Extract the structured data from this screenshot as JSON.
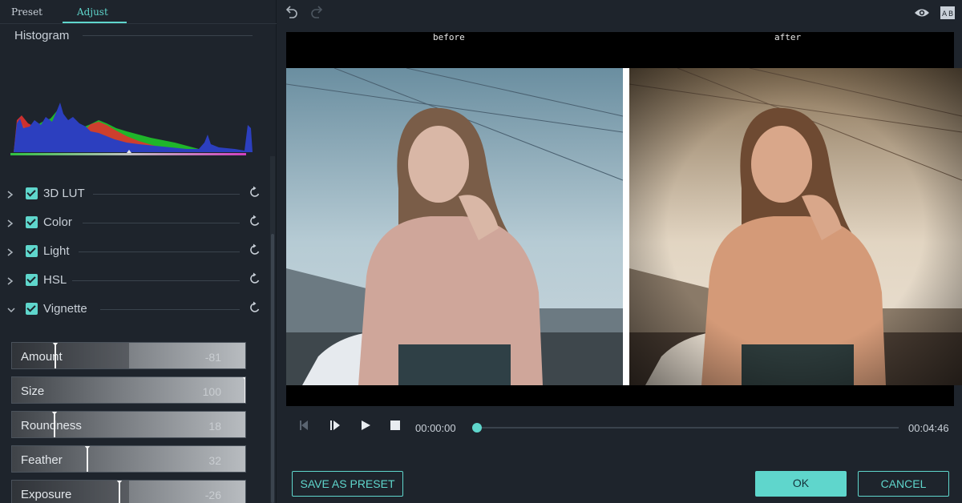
{
  "tabs": {
    "preset": "Preset",
    "adjust": "Adjust",
    "active": "adjust"
  },
  "histogram": {
    "title": "Histogram"
  },
  "sections": [
    {
      "label": "3D LUT",
      "checked": true,
      "expanded": false
    },
    {
      "label": "Color",
      "checked": true,
      "expanded": false
    },
    {
      "label": "Light",
      "checked": true,
      "expanded": false
    },
    {
      "label": "HSL",
      "checked": true,
      "expanded": false
    },
    {
      "label": "Vignette",
      "checked": true,
      "expanded": true
    }
  ],
  "vignette": {
    "sliders": [
      {
        "label": "Amount",
        "value": "-81",
        "level": -0.81
      },
      {
        "label": "Size",
        "value": "100",
        "level": 1.0
      },
      {
        "label": "Roundness",
        "value": "18",
        "level": 0.18
      },
      {
        "label": "Feather",
        "value": "32",
        "level": 0.32
      },
      {
        "label": "Exposure",
        "value": "-26",
        "level": -0.26
      }
    ]
  },
  "toolbar": {
    "undo": "undo-icon",
    "redo": "redo-icon",
    "preview": "eye-icon",
    "compare": "ab-compare-icon"
  },
  "viewer": {
    "before_label": "before",
    "after_label": "after"
  },
  "playback": {
    "current_time": "00:00:00",
    "total_time": "00:04:46",
    "progress": 0.0
  },
  "actions": {
    "save_preset": "SAVE AS PRESET",
    "ok": "OK",
    "cancel": "CANCEL"
  },
  "colors": {
    "accent": "#5fd6cc",
    "background": "#1e242c",
    "viewer": "#000000"
  }
}
